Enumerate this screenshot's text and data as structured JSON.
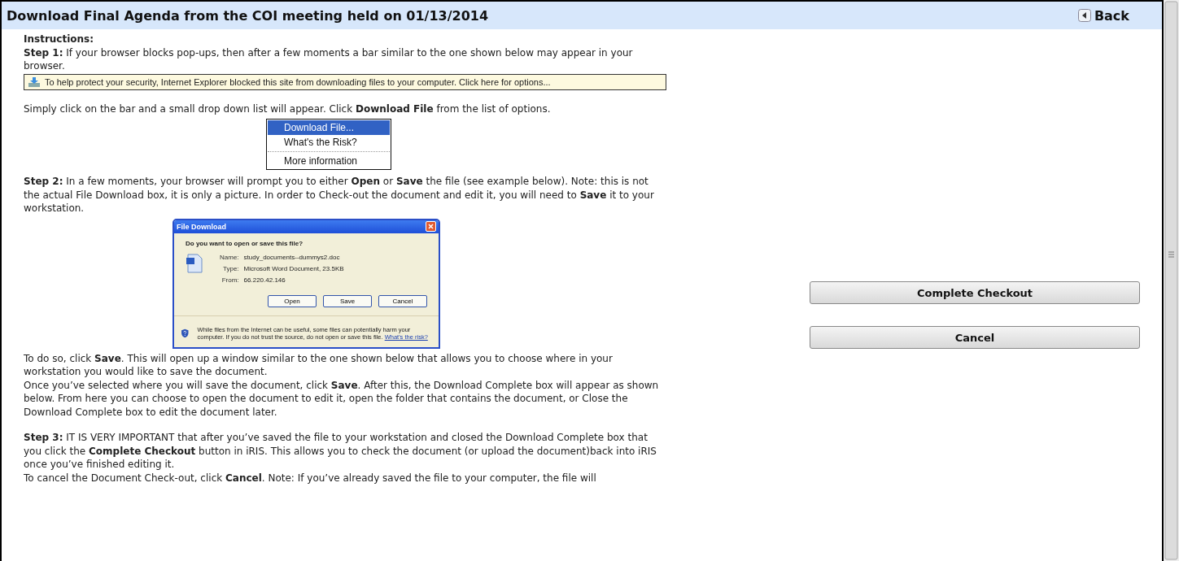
{
  "title": "Download Final Agenda from the COI meeting held on 01/13/2014",
  "back_button": {
    "label": "Back"
  },
  "sections": [
    {
      "items": [
        {
          "kind": "heading",
          "text": "**Instructions:**"
        },
        {
          "kind": "text",
          "text": "**Step 1:** If your browser blocks pop-ups, then after a few moments a bar similar to the one shown below may appear in your browser."
        },
        {
          "kind": "infobar",
          "text": "To help protect your security, Internet Explorer blocked this site from downloading files to your computer. Click here for options..."
        }
      ]
    },
    {
      "items": [
        {
          "kind": "text",
          "text": "Simply click on the bar and a small drop down list will appear. Click **Download File** from the list of options."
        },
        {
          "kind": "menu",
          "items": [
            {
              "kind": "item",
              "label": "Download File...",
              "selected": true
            },
            {
              "kind": "item",
              "label": "What's the Risk?",
              "selected": false
            },
            {
              "kind": "separator"
            },
            {
              "kind": "item",
              "label": "More information",
              "selected": false
            }
          ]
        },
        {
          "kind": "text",
          "text": "**Step 2:** In a few moments, your browser will prompt you to either **Open** or **Save** the file (see example below). Note: this is not the actual File Download box, it is only a picture. In order to Check-out the document and edit it, you will need to **Save** it to your workstation."
        },
        {
          "kind": "dialog",
          "title": "File Download",
          "question": "Do you want to open or save this file?",
          "fields": [
            {
              "label": "Name:",
              "value": "study_documents--dummys2.doc"
            },
            {
              "label": "Type:",
              "value": "Microsoft Word Document, 23.5KB"
            },
            {
              "label": "From:",
              "value": "66.220.42.146"
            }
          ],
          "buttons": [
            "Open",
            "Save",
            "Cancel"
          ],
          "warning": "While files from the Internet can be useful, some files can potentially harm your computer. If you do not trust the source, do not open or save this file.",
          "warning_link": "What's the risk?"
        },
        {
          "kind": "text",
          "text": "To do so, click **Save**. This will open up a window similar to the one shown below that allows you to choose where in your workstation you would like to save the document."
        },
        {
          "kind": "text",
          "text": "Once you’ve selected where you will save the document, click **Save**. After this, the Download Complete box will appear as shown below. From here you can choose to open the document to edit it, open the folder that contains the document, or Close the Download Complete box to edit the document later."
        }
      ]
    },
    {
      "items": [
        {
          "kind": "text",
          "text": "**Step 3:** IT IS VERY IMPORTANT that after you’ve saved the file to your workstation and closed the Download Complete box that you click the **Complete Checkout** button in iRIS. This allows you to check the document (or upload the document)back into iRIS once you’ve finished editing it."
        },
        {
          "kind": "text",
          "text": "To cancel the Document Check-out, click **Cancel**. Note: If you’ve already saved the file to your computer, the file will"
        }
      ]
    }
  ],
  "actions": [
    "Complete Checkout",
    "Cancel"
  ]
}
